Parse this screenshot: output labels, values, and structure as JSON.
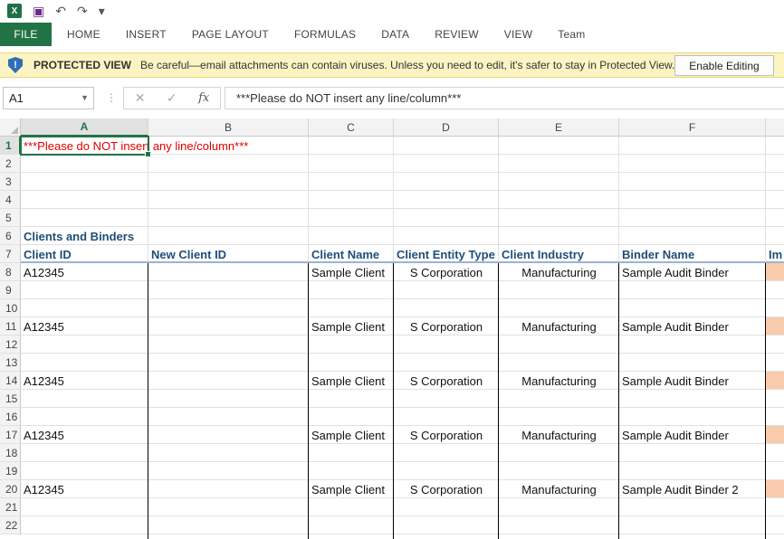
{
  "quick_access": {
    "app_icon": "X",
    "undo_symbol": "↶",
    "redo_symbol": "↷",
    "customize_symbol": "▾"
  },
  "ribbon": {
    "tabs": [
      "FILE",
      "HOME",
      "INSERT",
      "PAGE LAYOUT",
      "FORMULAS",
      "DATA",
      "REVIEW",
      "VIEW",
      "Team"
    ],
    "accent_color": "#217346"
  },
  "protected_view": {
    "title": "PROTECTED VIEW",
    "message": "Be careful—email attachments can contain viruses. Unless you need to edit, it's safer to stay in Protected View.",
    "button": "Enable Editing",
    "icon_glyph": "!"
  },
  "formula_bar": {
    "name_box": "A1",
    "cancel_symbol": "✕",
    "enter_symbol": "✓",
    "fx_symbol": "fx",
    "content": "***Please do NOT insert any line/column***"
  },
  "sheet": {
    "columns": [
      "A",
      "B",
      "C",
      "D",
      "E",
      "F"
    ],
    "rows": [
      "1",
      "2",
      "3",
      "4",
      "5",
      "6",
      "7",
      "8",
      "9",
      "10",
      "11",
      "12",
      "13",
      "14",
      "15",
      "16",
      "17",
      "18",
      "19",
      "20",
      "21",
      "22"
    ],
    "warning": "***Please do NOT insert any line/column***",
    "section_title": "Clients and Binders",
    "headers": [
      "Client ID",
      "New Client ID",
      "Client Name",
      "Client Entity Type",
      "Client Industry",
      "Binder Name",
      "Im"
    ],
    "records": [
      {
        "id": "A12345",
        "new_id": "",
        "name": "Sample Client",
        "entity": "S Corporation",
        "industry": "Manufacturing",
        "binder": "Sample Audit Binder"
      },
      {
        "id": "A12345",
        "new_id": "",
        "name": "Sample Client",
        "entity": "S Corporation",
        "industry": "Manufacturing",
        "binder": "Sample Audit Binder"
      },
      {
        "id": "A12345",
        "new_id": "",
        "name": "Sample Client",
        "entity": "S Corporation",
        "industry": "Manufacturing",
        "binder": "Sample Audit Binder"
      },
      {
        "id": "A12345",
        "new_id": "",
        "name": "Sample Client",
        "entity": "S Corporation",
        "industry": "Manufacturing",
        "binder": "Sample Audit Binder"
      },
      {
        "id": "A12345",
        "new_id": "",
        "name": "Sample Client",
        "entity": "S Corporation",
        "industry": "Manufacturing",
        "binder": "Sample Audit Binder 2"
      }
    ]
  }
}
